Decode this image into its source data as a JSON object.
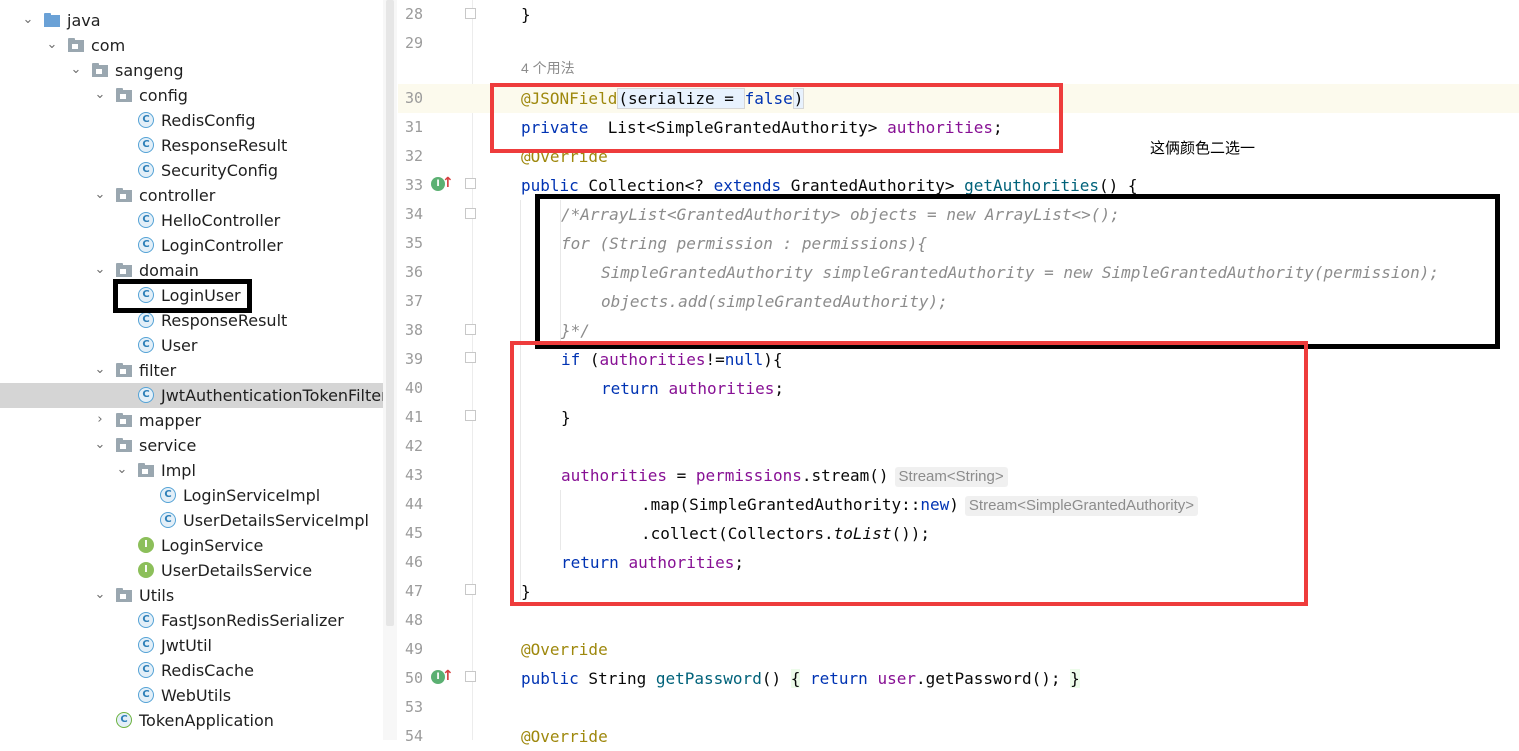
{
  "project_tree": {
    "items": [
      {
        "label": "java",
        "icon": "folder-source-icon",
        "arrow": "expanded"
      },
      {
        "label": "com",
        "icon": "package-icon",
        "arrow": "expanded"
      },
      {
        "label": "sangeng",
        "icon": "package-icon",
        "arrow": "expanded"
      },
      {
        "label": "config",
        "icon": "package-icon",
        "arrow": "expanded"
      },
      {
        "label": "RedisConfig",
        "icon": "class-icon"
      },
      {
        "label": "ResponseResult",
        "icon": "class-icon"
      },
      {
        "label": "SecurityConfig",
        "icon": "class-icon"
      },
      {
        "label": "controller",
        "icon": "package-icon",
        "arrow": "expanded"
      },
      {
        "label": "HelloController",
        "icon": "class-icon"
      },
      {
        "label": "LoginController",
        "icon": "class-icon"
      },
      {
        "label": "domain",
        "icon": "package-icon",
        "arrow": "expanded"
      },
      {
        "label": "LoginUser",
        "icon": "class-icon"
      },
      {
        "label": "ResponseResult",
        "icon": "class-icon"
      },
      {
        "label": "User",
        "icon": "class-icon"
      },
      {
        "label": "filter",
        "icon": "package-icon",
        "arrow": "expanded"
      },
      {
        "label": "JwtAuthenticationTokenFilter",
        "icon": "class-icon",
        "selected": true
      },
      {
        "label": "mapper",
        "icon": "package-icon",
        "arrow": "collapsed"
      },
      {
        "label": "service",
        "icon": "package-icon",
        "arrow": "expanded"
      },
      {
        "label": "Impl",
        "icon": "package-icon",
        "arrow": "expanded"
      },
      {
        "label": "LoginServiceImpl",
        "icon": "class-icon"
      },
      {
        "label": "UserDetailsServiceImpl",
        "icon": "class-icon"
      },
      {
        "label": "LoginService",
        "icon": "interface-icon"
      },
      {
        "label": "UserDetailsService",
        "icon": "interface-icon"
      },
      {
        "label": "Utils",
        "icon": "package-icon",
        "arrow": "expanded"
      },
      {
        "label": "FastJsonRedisSerializer",
        "icon": "class-icon"
      },
      {
        "label": "JwtUtil",
        "icon": "class-icon"
      },
      {
        "label": "RedisCache",
        "icon": "class-icon"
      },
      {
        "label": "WebUtils",
        "icon": "class-icon"
      },
      {
        "label": "TokenApplication",
        "icon": "spring-app-icon"
      }
    ]
  },
  "editor": {
    "line_numbers": [
      "28",
      "29",
      "30",
      "31",
      "32",
      "33",
      "34",
      "35",
      "36",
      "37",
      "38",
      "39",
      "40",
      "41",
      "42",
      "43",
      "44",
      "45",
      "46",
      "47",
      "48",
      "49",
      "50",
      "53",
      "54"
    ],
    "usages_hint": "4 个用法",
    "hint_stream_string": "Stream<String>",
    "hint_stream_authority": "Stream<SimpleGrantedAuthority>",
    "code": {
      "l28": "}",
      "l30_ann": "@JSONField",
      "l30_rest": "(serialize = ",
      "l30_false": "false",
      "l30_close": ")",
      "l31_kw": "private",
      "l31_type": "  List<SimpleGrantedAuthority> ",
      "l31_field": "authorities",
      "l31_end": ";",
      "l32": "@Override",
      "l33_kw": "public",
      "l33_a": " Collection<? ",
      "l33_ext": "extends",
      "l33_b": " GrantedAuthority> ",
      "l33_m": "getAuthorities",
      "l33_c": "() {",
      "l34": "/*ArrayList<GrantedAuthority> objects = new ArrayList<>();",
      "l35": "for (String permission : permissions){",
      "l36": "SimpleGrantedAuthority simpleGrantedAuthority = new SimpleGrantedAuthority(permission);",
      "l37": "objects.add(simpleGrantedAuthority);",
      "l38": "}*/",
      "l39_kw": "if",
      "l39_a": " (",
      "l39_f": "authorities",
      "l39_b": "!=",
      "l39_null": "null",
      "l39_c": "){",
      "l40_kw": "return",
      "l40_f": "authorities",
      "l40_end": ";",
      "l41": "}",
      "l43_f": "authorities",
      "l43_a": " = ",
      "l43_p": "permissions",
      "l43_b": ".stream()",
      "l44_a": ".map(SimpleGrantedAuthority::",
      "l44_new": "new",
      "l44_b": ")",
      "l45_a": ".collect(Collectors.",
      "l45_m": "toList",
      "l45_b": "());",
      "l46_kw": "return",
      "l46_f": "authorities",
      "l46_end": ";",
      "l47": "}",
      "l49": "@Override",
      "l50_kw": "public",
      "l50_a": " String ",
      "l50_m": "getPassword",
      "l50_b": "()",
      "l50_brace": "{",
      "l50_ret": "return",
      "l50_u": "user",
      "l50_c": ".getPassword();",
      "l50_brace2": "}",
      "l54": "@Override"
    }
  },
  "annotation_note": "这俩颜色二选一",
  "colors": {
    "red_box": "#ee3c3c",
    "black_box": "#000000",
    "keyword": "#0033b3",
    "annotation": "#9e880d",
    "field": "#871094",
    "comment": "#8c8c8c",
    "method": "#00627a"
  }
}
